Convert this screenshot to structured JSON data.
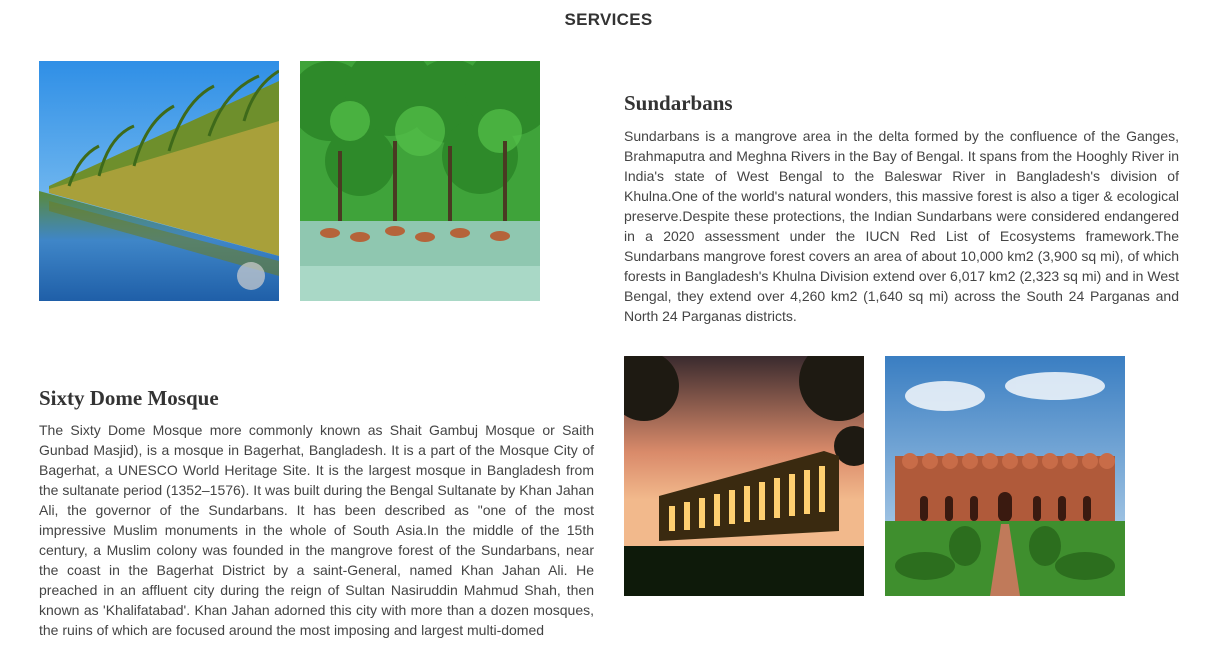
{
  "header": {
    "title": "SERVICES"
  },
  "sections": [
    {
      "heading": "Sundarbans",
      "text": "Sundarbans is a mangrove area in the delta formed by the confluence of the Ganges, Brahmaputra and Meghna Rivers in the Bay of Bengal. It spans from the Hooghly River in India's state of West Bengal to the Baleswar River in Bangladesh's division of Khulna.One of the world's natural wonders, this massive forest is also a tiger & ecological preserve.Despite these protections, the Indian Sundarbans were considered endangered in a 2020 assessment under the IUCN Red List of Ecosystems framework.The Sundarbans mangrove forest covers an area of about 10,000 km2 (3,900 sq mi), of which forests in Bangladesh's Khulna Division extend over 6,017 km2 (2,323 sq mi) and in West Bengal, they extend over 4,260 km2 (1,640 sq mi) across the South 24 Parganas and North 24 Parganas districts."
    },
    {
      "heading": "Sixty Dome Mosque",
      "text": "The Sixty Dome Mosque more commonly known as Shait Gambuj Mosque or Saith Gunbad Masjid), is a mosque in Bagerhat, Bangladesh. It is a part of the Mosque City of Bagerhat, a UNESCO World Heritage Site. It is the largest mosque in Bangladesh from the sultanate period (1352–1576). It was built during the Bengal Sultanate by Khan Jahan Ali, the governor of the Sundarbans. It has been described as \"one of the most impressive Muslim monuments in the whole of South Asia.In the middle of the 15th century, a Muslim colony was founded in the mangrove forest of the Sundarbans, near the coast in the Bagerhat District by a saint-General, named Khan Jahan Ali. He preached in an affluent city during the reign of Sultan Nasiruddin Mahmud Shah, then known as 'Khalifatabad'. Khan Jahan adorned this city with more than a dozen mosques, the ruins of which are focused around the most imposing and largest multi-domed"
    }
  ],
  "images": {
    "mangrove_river": "mangrove-river-photo",
    "deer_forest": "deer-forest-photo",
    "mosque_night": "mosque-night-photo",
    "mosque_day": "mosque-day-photo"
  }
}
